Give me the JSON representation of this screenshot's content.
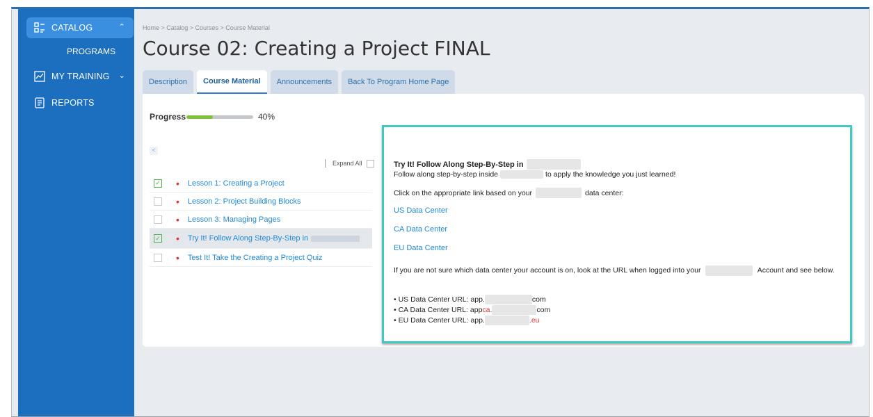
{
  "sidebar": {
    "catalog_label": "CATALOG",
    "programs_label": "PROGRAMS",
    "my_training_label": "MY TRAINING",
    "reports_label": "REPORTS"
  },
  "breadcrumb": "Home > Catalog > Courses > Course Material",
  "page_title": "Course 02: Creating a Project FINAL",
  "tabs": [
    {
      "label": "Description"
    },
    {
      "label": "Course Material"
    },
    {
      "label": "Announcements"
    },
    {
      "label": "Back To Program Home Page"
    }
  ],
  "active_tab": "Course Material",
  "progress": {
    "label": "Progress",
    "percent_text": "40%",
    "value": 0.4
  },
  "outline": {
    "collapse_label": "<",
    "expand_all_label": "Expand All",
    "lessons": [
      {
        "label": "Lesson 1: Creating a Project",
        "completed": true
      },
      {
        "label": "Lesson 2: Project Building Blocks",
        "completed": false
      },
      {
        "label": "Lesson 3: Managing Pages",
        "completed": false
      },
      {
        "label": "Try It! Follow Along Step-By-Step in",
        "completed": true,
        "selected": true
      },
      {
        "label": "Test It! Take the Creating a Project Quiz",
        "completed": false
      }
    ]
  },
  "content": {
    "heading": "Try It! Follow Along Step-By-Step in",
    "follow_prefix": "Follow along step-by-step inside",
    "follow_suffix": "to apply the knowledge you just learned!",
    "click_prefix": "Click on the appropriate link based on your",
    "click_suffix": "data center:",
    "links": [
      "US Data Center",
      "CA Data Center",
      "EU Data Center"
    ],
    "note_prefix": "If you are not sure which data center your account is on, look at the URL when logged into your",
    "note_suffix": "Account and see below.",
    "urls": [
      {
        "prefix": "US Data Center URL: app.",
        "highlight": "",
        "suffix": "com"
      },
      {
        "prefix": "CA Data Center URL: app",
        "highlight": "ca.",
        "suffix": "com"
      },
      {
        "prefix": "EU Data Center URL: app.",
        "highlight": ".eu",
        "suffix": ""
      }
    ]
  },
  "colors": {
    "sidebar": "#1b6fbe",
    "sidebar_active": "#3a8fe0",
    "link": "#1e88d4",
    "progress_fill": "#7ec23c",
    "viewer_border": "#44c7c3",
    "required_dot": "#e03030"
  }
}
